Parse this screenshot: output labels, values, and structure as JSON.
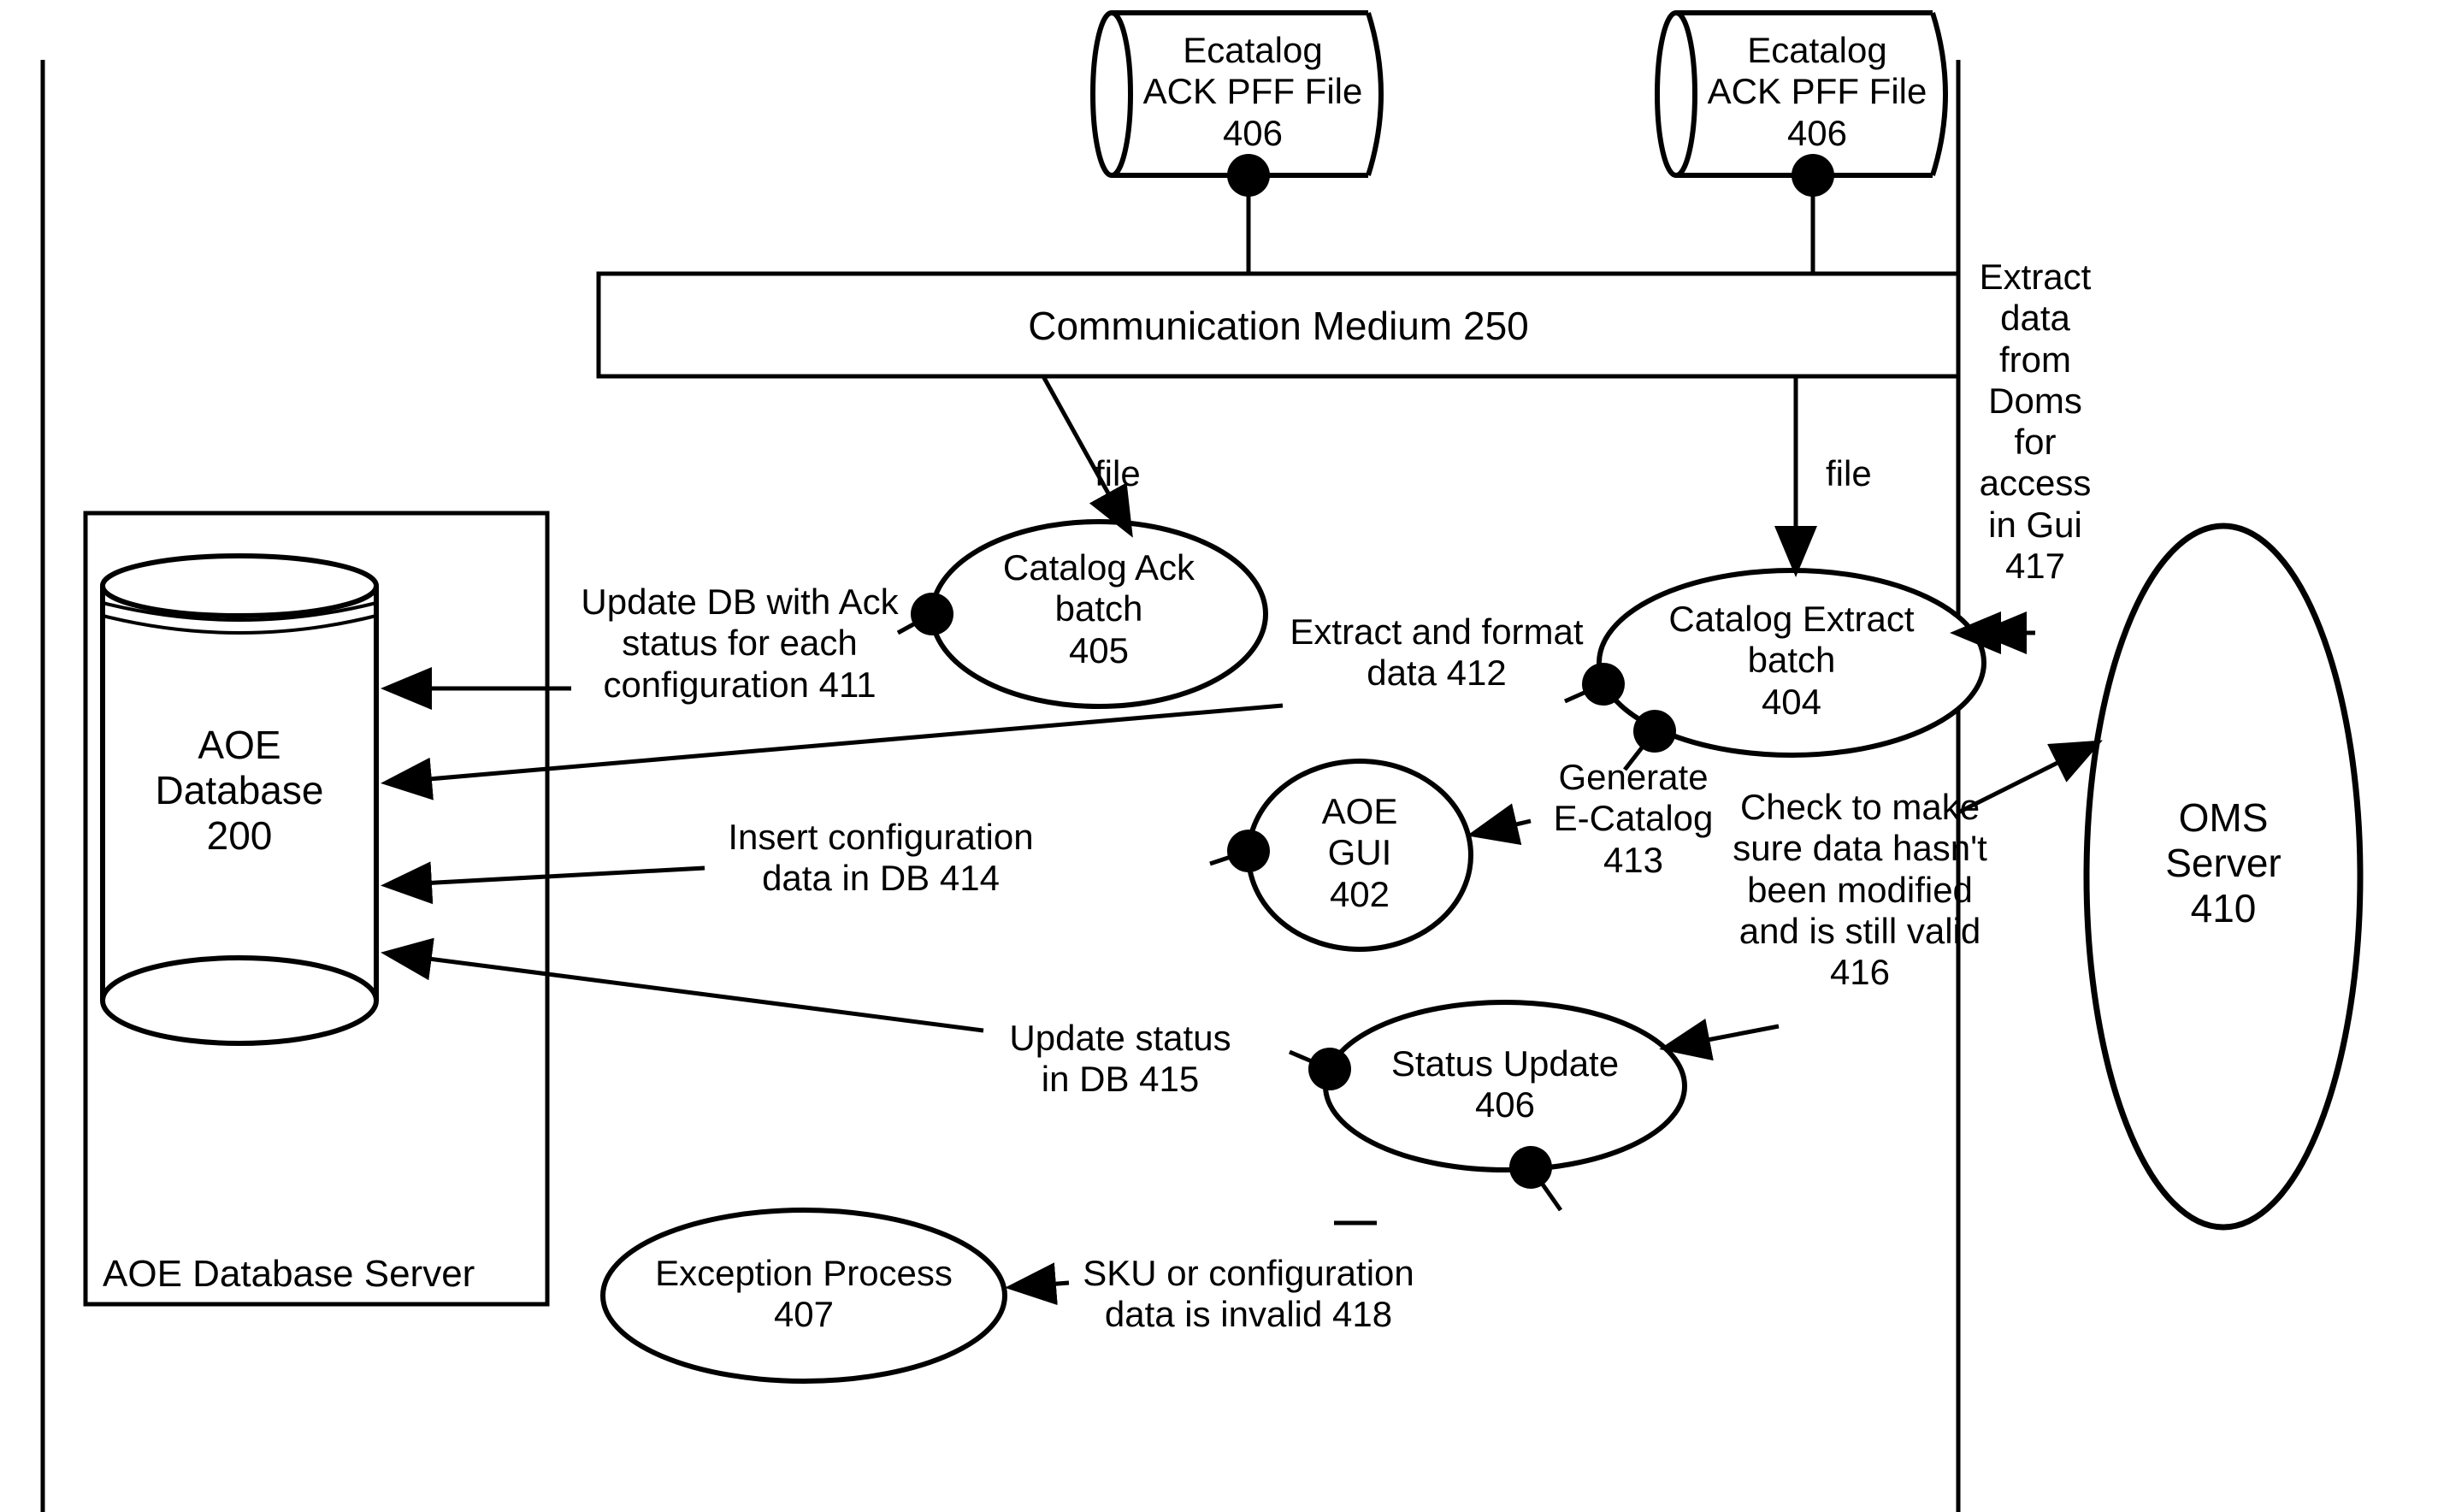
{
  "cylinders": {
    "ecatalog1": {
      "line1": "Ecatalog",
      "line2": "ACK PFF File",
      "line3": "406"
    },
    "ecatalog2": {
      "line1": "Ecatalog",
      "line2": "ACK PFF File",
      "line3": "406"
    },
    "aoe_db": {
      "line1": "AOE",
      "line2": "Database",
      "line3": "200"
    }
  },
  "boxes": {
    "comm_medium": "Communication Medium  250",
    "aoe_server": "AOE Database Server"
  },
  "ellipses": {
    "catalog_ack": {
      "line1": "Catalog Ack",
      "line2": "batch",
      "line3": "405"
    },
    "catalog_extract": {
      "line1": "Catalog Extract",
      "line2": "batch",
      "line3": "404"
    },
    "aoe_gui": {
      "line1": "AOE",
      "line2": "GUI",
      "line3": "402"
    },
    "status_update": {
      "line1": "Status Update",
      "line2": "406"
    },
    "exception_process": {
      "line1": "Exception Process",
      "line2": "407"
    },
    "oms_server": {
      "line1": "OMS",
      "line2": "Server",
      "line3": "410"
    }
  },
  "labels": {
    "file1": "file",
    "file2": "file",
    "update_db_ack": {
      "line1": "Update DB with Ack",
      "line2": "status for each",
      "line3": "configuration 411"
    },
    "extract_format": {
      "line1": "Extract and format",
      "line2": "data 412"
    },
    "generate_ecatalog": {
      "line1": "Generate",
      "line2": "E-Catalog",
      "line3": "413"
    },
    "insert_config": {
      "line1": "Insert configuration",
      "line2": "data in DB 414"
    },
    "update_status": {
      "line1": "Update status",
      "line2": "in DB 415"
    },
    "check_data": {
      "line1": "Check to make",
      "line2": "sure data hasn't",
      "line3": "been modified",
      "line4": "and is still valid",
      "line5": "416"
    },
    "extract_data_doms": {
      "line1": "Extract",
      "line2": "data",
      "line3": "from",
      "line4": "Doms",
      "line5": "for",
      "line6": "access",
      "line7": "in Gui",
      "line8": "417"
    },
    "sku_invalid": {
      "line1": "SKU or configuration",
      "line2": "data is invalid 418"
    }
  }
}
